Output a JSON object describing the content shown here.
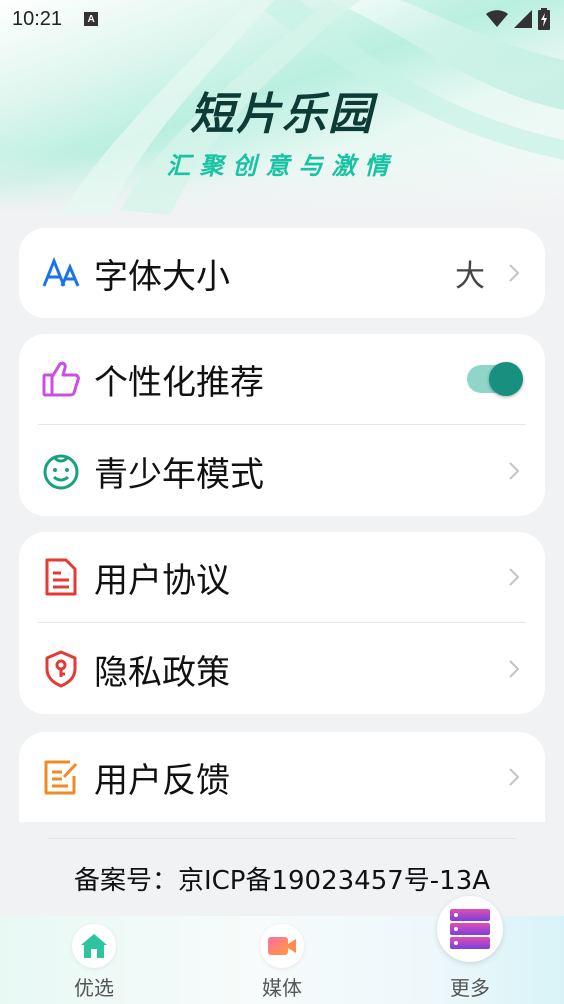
{
  "status_bar": {
    "time": "10:21",
    "notification_icon": "A"
  },
  "header": {
    "app_title": "短片乐园",
    "slogan": "汇聚创意与激情"
  },
  "settings": {
    "font_size": {
      "label": "字体大小",
      "value": "大",
      "icon": "font-size-icon"
    },
    "personalized": {
      "label": "个性化推荐",
      "enabled": true,
      "icon": "thumbs-up-icon"
    },
    "teen_mode": {
      "label": "青少年模式",
      "icon": "child-face-icon"
    },
    "user_agreement": {
      "label": "用户协议",
      "icon": "document-icon"
    },
    "privacy_policy": {
      "label": "隐私政策",
      "icon": "shield-key-icon"
    },
    "feedback": {
      "label": "用户反馈",
      "icon": "edit-note-icon"
    }
  },
  "footer": {
    "icp": "备案号：京ICP备19023457号-13A"
  },
  "tabs": [
    {
      "label": "优选",
      "icon": "home-icon"
    },
    {
      "label": "媒体",
      "icon": "video-camera-icon"
    },
    {
      "label": "更多",
      "icon": "server-stack-icon"
    }
  ],
  "colors": {
    "accent": "#17907f",
    "slogan": "#18c3a3",
    "font_icon": "#1a73e8",
    "thumb_icon": "#c84fe0",
    "child_icon": "#17a17f",
    "doc_icon": "#e53935",
    "shield_icon": "#e53935",
    "edit_icon": "#f08a24"
  }
}
